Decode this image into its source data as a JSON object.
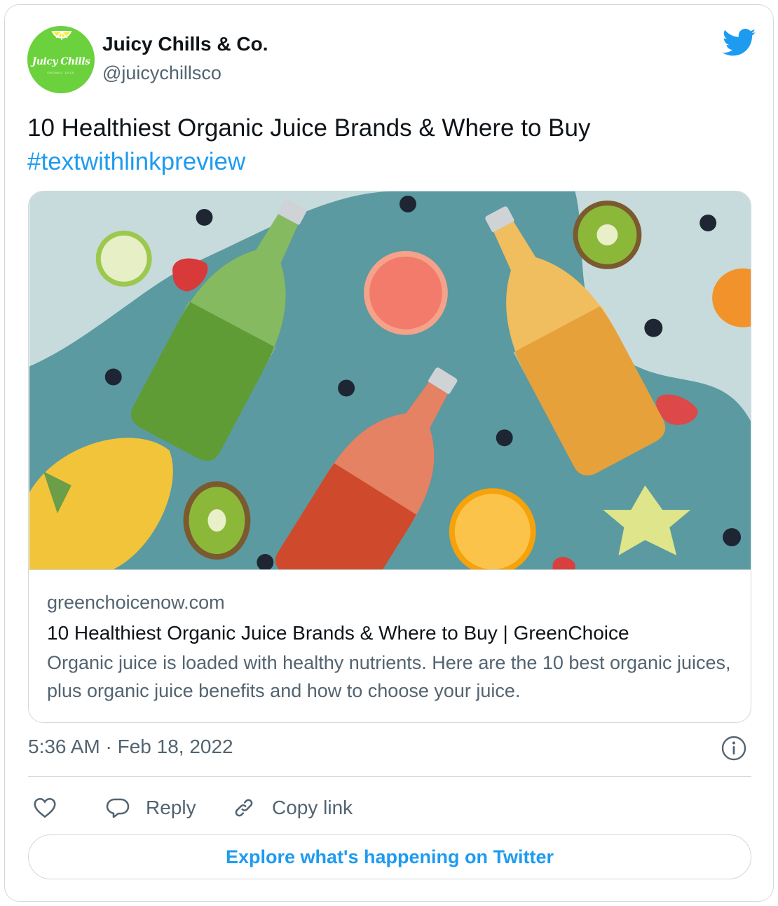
{
  "author": {
    "display_name": "Juicy Chills & Co.",
    "handle": "@juicychillsco",
    "avatar_text": "Juicy Chills",
    "avatar_subtext": "ORGANIC JUICE"
  },
  "tweet": {
    "text": "10 Healthiest Organic Juice Brands & Where to Buy",
    "hashtag": "#textwithlinkpreview"
  },
  "link_preview": {
    "domain": "greenchoicenow.com",
    "title": "10 Healthiest Organic Juice Brands & Where to Buy | GreenChoice",
    "description": "Organic juice is loaded with healthy nutrients. Here are the 10 best organic juices, plus organic juice benefits and how to choose your juice."
  },
  "timestamp": "5:36 AM · Feb 18, 2022",
  "actions": {
    "reply_label": "Reply",
    "copy_link_label": "Copy link"
  },
  "explore_button": "Explore what's happening on Twitter",
  "colors": {
    "accent": "#1d9bf0",
    "secondary_text": "#536471",
    "border": "#cfd9de",
    "avatar_green": "#6bd13c"
  },
  "icons": [
    "twitter-bird-icon",
    "info-icon",
    "heart-icon",
    "reply-bubble-icon",
    "link-icon"
  ]
}
